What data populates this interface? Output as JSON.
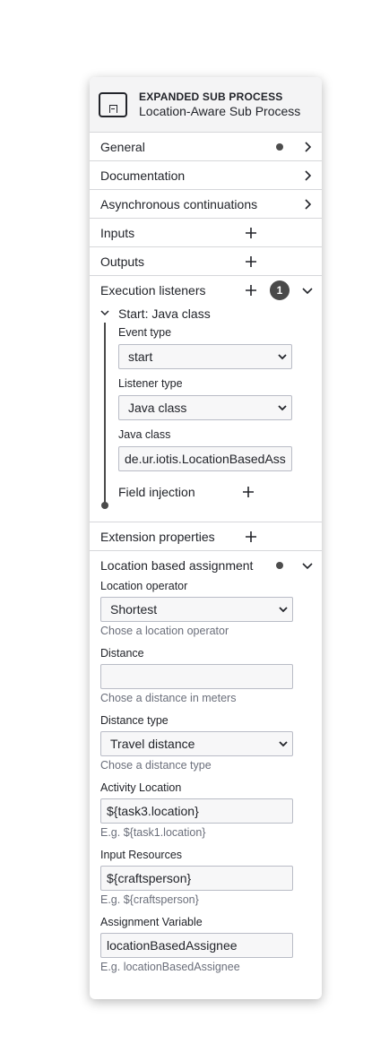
{
  "header": {
    "type": "EXPANDED SUB PROCESS",
    "name": "Location-Aware Sub Process"
  },
  "groups": {
    "general": "General",
    "documentation": "Documentation",
    "async": "Asynchronous continuations",
    "inputs": "Inputs",
    "outputs": "Outputs",
    "execution_listeners": "Execution listeners",
    "execution_listeners_count": "1",
    "extension_properties": "Extension properties",
    "location_assignment": "Location based assignment"
  },
  "listener": {
    "title": "Start: Java class",
    "event_type_label": "Event type",
    "event_type_value": "start",
    "listener_type_label": "Listener type",
    "listener_type_value": "Java class",
    "java_class_label": "Java class",
    "java_class_value": "de.ur.iotis.LocationBasedAss",
    "field_injection": "Field injection"
  },
  "location": {
    "operator_label": "Location operator",
    "operator_value": "Shortest",
    "operator_hint": "Chose a location operator",
    "distance_label": "Distance",
    "distance_value": "",
    "distance_hint": "Chose a distance in meters",
    "distance_type_label": "Distance type",
    "distance_type_value": "Travel distance",
    "distance_type_hint": "Chose a distance type",
    "activity_location_label": "Activity Location",
    "activity_location_value": "${task3.location}",
    "activity_location_hint": "E.g. ${task1.location}",
    "input_resources_label": "Input Resources",
    "input_resources_value": "${craftsperson}",
    "input_resources_hint": "E.g. ${craftsperson}",
    "assignment_variable_label": "Assignment Variable",
    "assignment_variable_value": "locationBasedAssignee",
    "assignment_variable_hint": "E.g. locationBasedAssignee"
  },
  "icons": {
    "header": "subprocess-expanded-icon",
    "expand": "chevron-right-icon",
    "collapse": "chevron-down-icon",
    "add": "plus-icon"
  }
}
